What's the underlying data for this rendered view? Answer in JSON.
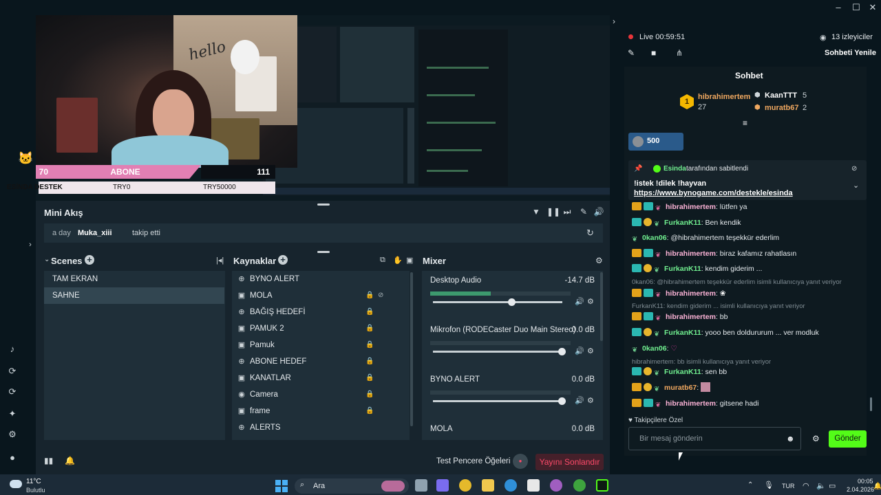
{
  "overlay": {
    "sub_count": "70",
    "sub_label": "ABONE",
    "sub_goal": "111",
    "donation_label": "ESİNDA DESTEK",
    "donation_current": "TRY0",
    "donation_goal": "TRY50000",
    "hello_text": "hello"
  },
  "activity": {
    "title": "Mini Akış",
    "row_time": "a day",
    "row_user": "Muka_xiii",
    "row_action": "takip etti"
  },
  "scenes": {
    "title": "Scenes",
    "items": [
      "TAM EKRAN",
      "SAHNE"
    ],
    "selected_index": 1
  },
  "sources": {
    "title": "Kaynaklar",
    "items": [
      {
        "label": "BYNO ALERT",
        "icon": "globe-icon"
      },
      {
        "label": "MOLA",
        "icon": "image-icon"
      },
      {
        "label": "BAĞIŞ HEDEFİ",
        "icon": "globe-icon"
      },
      {
        "label": "PAMUK 2",
        "icon": "image-icon"
      },
      {
        "label": "Pamuk",
        "icon": "image-icon"
      },
      {
        "label": "ABONE HEDEF",
        "icon": "globe-icon"
      },
      {
        "label": "KANATLAR",
        "icon": "image-icon"
      },
      {
        "label": "Camera",
        "icon": "camera-icon"
      },
      {
        "label": "frame",
        "icon": "image-icon"
      },
      {
        "label": "ALERTS",
        "icon": "globe-icon"
      }
    ]
  },
  "mixer": {
    "title": "Mixer",
    "channels": [
      {
        "name": "Desktop Audio",
        "db": "-14.7 dB",
        "level": 0.43,
        "volume": 0.6
      },
      {
        "name": "Mikrofon (RODECaster Duo Main Stereo)",
        "db": "0.0 dB",
        "level": 0.0,
        "volume": 1.0
      },
      {
        "name": "BYNO ALERT",
        "db": "0.0 dB",
        "level": 0.0,
        "volume": 1.0
      },
      {
        "name": "MOLA",
        "db": "0.0 dB",
        "level": 0.0,
        "volume": 1.0
      }
    ]
  },
  "bottom": {
    "test_label": "Test Pencere Öğeleri",
    "end_stream": "Yayını Sonlandır"
  },
  "stream": {
    "live_label": "Live",
    "duration": "00:59:51",
    "viewers": "13 izleyiciler",
    "refresh_chat": "Sohbeti Yenile"
  },
  "chat": {
    "title": "Sohbet",
    "leaders": [
      {
        "rank": "1",
        "name": "hibrahimertem",
        "count": "27"
      },
      {
        "name": "KaanTTT",
        "count": "5"
      },
      {
        "name": "muratb67",
        "count": "2"
      }
    ],
    "gift_count": "500",
    "pinned_by_user": "Esinda",
    "pinned_by_text": "tarafından sabitlendi",
    "pinned_message": "!istek !dilek !hayvan",
    "pinned_link": "https://www.bynogame.com/destekle/esinda",
    "messages": [
      {
        "user": "hibrahimertem",
        "color": "pink",
        "text": ": lütfen ya"
      },
      {
        "user": "FurkanK11",
        "color": "green",
        "text": ": Ben kendik"
      },
      {
        "user": "0kan06",
        "color": "green",
        "text": ": @hibrahimertem teşekkür ederlim"
      },
      {
        "user": "hibrahimertem",
        "color": "pink",
        "text": ": biraz kafamız rahatlasın"
      },
      {
        "user": "FurkanK11",
        "color": "green",
        "text": ": kendim giderim ..."
      },
      {
        "reply": "0kan06: @hibrahimertem teşekkür ederlim isimli kullanıcıya yanıt veriyor"
      },
      {
        "user": "hibrahimertem",
        "color": "pink",
        "text": ":"
      },
      {
        "reply": "FurkanK11: kendim giderim ... isimli kullanıcıya yanıt veriyor"
      },
      {
        "user": "hibrahimertem",
        "color": "pink",
        "text": ": bb"
      },
      {
        "user": "FurkanK11",
        "color": "green",
        "text": ": yooo ben doldururum ... ver modluk"
      },
      {
        "user": "0kan06",
        "color": "green",
        "text": ":"
      },
      {
        "reply": "hibrahimertem: bb isimli kullanıcıya yanıt veriyor"
      },
      {
        "user": "FurkanK11",
        "color": "green",
        "text": ": sen bb"
      },
      {
        "user": "muratb67",
        "color": "orange",
        "text": ":"
      },
      {
        "user": "hibrahimertem",
        "color": "pink",
        "text": ": gitsene hadi"
      }
    ],
    "followers_only": "Takipçilere Özel",
    "input_placeholder": "Bir mesaj gönderin",
    "send_label": "Gönder"
  },
  "taskbar": {
    "weather_temp": "11°C",
    "weather_desc": "Bulutlu",
    "search_placeholder": "Ara",
    "lang": "TUR",
    "time": "00:05",
    "date": "2.04.2026"
  },
  "colors": {
    "accent": "#53fc18",
    "end_stream": "#ff4a6a",
    "live_dot": "#e8353a",
    "pink_overlay": "#e27fb3"
  }
}
